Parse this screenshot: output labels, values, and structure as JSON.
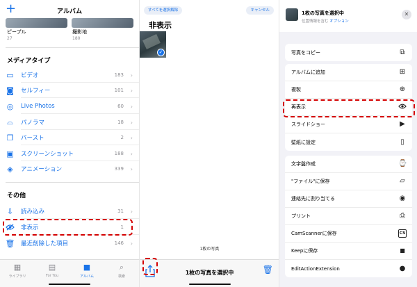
{
  "albums_panel": {
    "title": "アルバム",
    "plus": "+",
    "people": [
      {
        "label": "ピープル",
        "count": "27"
      },
      {
        "label": "撮影地",
        "count": "180"
      }
    ],
    "media_types_title": "メディアタイプ",
    "media_types": [
      {
        "label": "ビデオ",
        "count": "183",
        "icon": "video-icon"
      },
      {
        "label": "セルフィー",
        "count": "101",
        "icon": "selfie-icon"
      },
      {
        "label": "Live Photos",
        "count": "60",
        "icon": "live-photos-icon"
      },
      {
        "label": "パノラマ",
        "count": "18",
        "icon": "panorama-icon"
      },
      {
        "label": "バースト",
        "count": "2",
        "icon": "burst-icon"
      },
      {
        "label": "スクリーンショット",
        "count": "188",
        "icon": "screenshot-icon"
      },
      {
        "label": "アニメーション",
        "count": "339",
        "icon": "animation-icon"
      }
    ],
    "other_title": "その他",
    "other": [
      {
        "label": "読み込み",
        "count": "31",
        "icon": "import-icon"
      },
      {
        "label": "非表示",
        "count": "1",
        "icon": "hidden-eye-icon"
      },
      {
        "label": "最近削除した項目",
        "count": "146",
        "icon": "trash-icon"
      }
    ],
    "tabs": [
      {
        "label": "ライブラリ",
        "icon": "library-icon"
      },
      {
        "label": "For You",
        "icon": "for-you-icon"
      },
      {
        "label": "アルバム",
        "icon": "albums-icon"
      },
      {
        "label": "検索",
        "icon": "search-icon"
      }
    ]
  },
  "hidden_panel": {
    "deselect_all": "すべてを選択解除",
    "cancel": "キャンセル",
    "title": "非表示",
    "count_label": "1枚の写真",
    "selected_label": "1枚の写真を選択中"
  },
  "share_sheet": {
    "title": "1枚の写真を選択中",
    "subtitle": "位置情報を含む",
    "options_link": "オプション",
    "groups": [
      [
        {
          "label": "写真をコピー",
          "icon": "copy-icon"
        }
      ],
      [
        {
          "label": "アルバムに追加",
          "icon": "add-album-icon"
        },
        {
          "label": "複製",
          "icon": "duplicate-icon"
        },
        {
          "label": "再表示",
          "icon": "eye-icon"
        },
        {
          "label": "スライドショー",
          "icon": "play-icon"
        },
        {
          "label": "壁紙に設定",
          "icon": "phone-icon"
        }
      ],
      [
        {
          "label": "文字盤作成",
          "icon": "watch-icon"
        },
        {
          "label": "\"ファイル\"に保存",
          "icon": "folder-icon"
        },
        {
          "label": "連絡先に割り当てる",
          "icon": "contact-icon"
        },
        {
          "label": "プリント",
          "icon": "print-icon"
        },
        {
          "label": "CamScannerに保存",
          "icon": "camscanner-icon"
        },
        {
          "label": "Keepに保存",
          "icon": "bookmark-icon"
        },
        {
          "label": "EditActionExtension",
          "icon": "circle-icon"
        }
      ]
    ]
  },
  "colors": {
    "accent": "#1a73e8",
    "highlight": "#d40000"
  }
}
